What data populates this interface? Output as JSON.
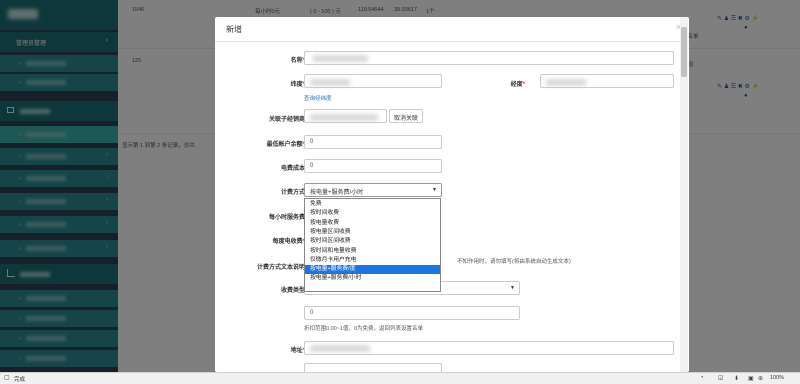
{
  "sidebar": {
    "menu_admin": "管理员管理",
    "groups": [],
    "chevron": "›"
  },
  "background_table": {
    "row1": {
      "id": "1546",
      "rate": "每小时0元",
      "range": "( 0 - 100 ) 元",
      "lng": "119.54644",
      "lat": "39.93617",
      "count": "1个",
      "extra": "黑名单"
    },
    "row2": {
      "id": "125",
      "extra": "A组"
    },
    "pagination_text": "显示第 1 到第 2 条记录，总共"
  },
  "modal": {
    "title": "新增",
    "close": "×",
    "fields": {
      "name_label": "名称",
      "lat_label": "纬度",
      "lng_label": "经度",
      "query_link": "查询经纬度",
      "dealer_label": "关联子经销商",
      "cancel_link_btn": "取消关联",
      "min_balance_label": "最低帐户余额",
      "min_balance_value": "0",
      "cost_label": "电费成本",
      "cost_value": "0",
      "billing_label": "计费方式",
      "billing_value": "按电量+服务费/小时",
      "hourly_fee_label": "每小时服务费",
      "kwh_fee_label": "每度电收费",
      "billing_text_label": "计费方式文本说明",
      "billing_text_help": "不知作用时，请勿填写(将由系统自动生成文本)",
      "charge_type_label": "收费类型",
      "discount_value": "0",
      "discount_help": "折扣范围0.00~1值，0为免费，返回列表设置名单",
      "address_label": "地址",
      "required_mark": "*"
    },
    "billing_options": [
      "免费",
      "按时间收费",
      "按电量收费",
      "按电量区间收费",
      "按时间区间收费",
      "按时间和电量收费",
      "仅微月卡用户充电",
      "按电量+服务费/度",
      "按电量+服务费/小时"
    ],
    "selected_option_index": 7
  },
  "statusbar": {
    "status": "完成",
    "zoom": "100%"
  }
}
